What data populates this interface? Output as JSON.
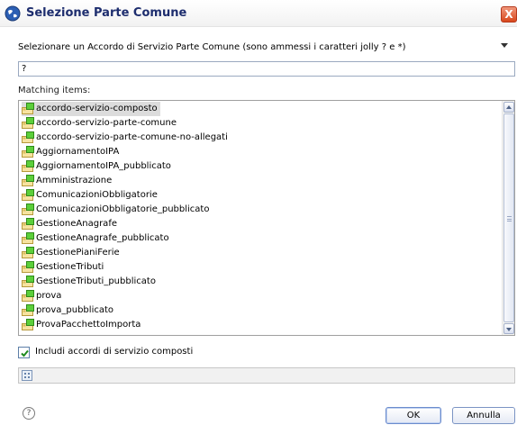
{
  "window": {
    "title": "Selezione Parte Comune",
    "close_label": "X"
  },
  "prompt": {
    "text": "Selezionare un Accordo di Servizio Parte Comune (sono ammessi i caratteri jolly ? e *)"
  },
  "filter": {
    "value": "?"
  },
  "matching_label": "Matching items:",
  "items": [
    {
      "label": "accordo-servizio-composto",
      "selected": true
    },
    {
      "label": "accordo-servizio-parte-comune",
      "selected": false
    },
    {
      "label": "accordo-servizio-parte-comune-no-allegati",
      "selected": false
    },
    {
      "label": "AggiornamentoIPA",
      "selected": false
    },
    {
      "label": "AggiornamentoIPA_pubblicato",
      "selected": false
    },
    {
      "label": "Amministrazione",
      "selected": false
    },
    {
      "label": "ComunicazioniObbligatorie",
      "selected": false
    },
    {
      "label": "ComunicazioniObbligatorie_pubblicato",
      "selected": false
    },
    {
      "label": "GestioneAnagrafe",
      "selected": false
    },
    {
      "label": "GestioneAnagrafe_pubblicato",
      "selected": false
    },
    {
      "label": "GestionePianiFerie",
      "selected": false
    },
    {
      "label": "GestioneTributi",
      "selected": false
    },
    {
      "label": "GestioneTributi_pubblicato",
      "selected": false
    },
    {
      "label": "prova",
      "selected": false
    },
    {
      "label": "prova_pubblicato",
      "selected": false
    },
    {
      "label": "ProvaPacchettoImporta",
      "selected": false
    }
  ],
  "item_icon": "package-folder-icon",
  "checkbox": {
    "label": "Includi accordi di servizio composti",
    "checked": true
  },
  "buttons": {
    "ok": "OK",
    "cancel": "Annulla"
  },
  "help_glyph": "?",
  "colors": {
    "title": "#1d2d6e",
    "close": "#d8481c",
    "selection": "#dcdcdc"
  }
}
